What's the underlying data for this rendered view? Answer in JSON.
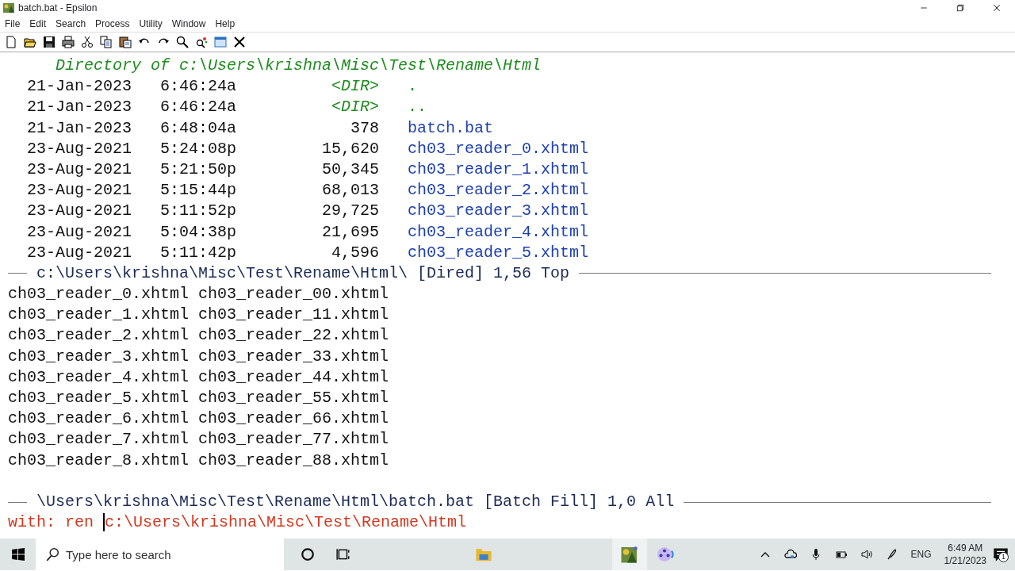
{
  "window": {
    "title": "batch.bat - Epsilon"
  },
  "menu": [
    "File",
    "Edit",
    "Search",
    "Process",
    "Utility",
    "Window",
    "Help"
  ],
  "dired": {
    "header": "Directory of c:\\Users\\krishna\\Misc\\Test\\Rename\\Html",
    "entries": [
      {
        "date": "21-Jan-2023",
        "time": "6:46:24a",
        "size": "<DIR>",
        "name": ".",
        "kind": "dir"
      },
      {
        "date": "21-Jan-2023",
        "time": "6:46:24a",
        "size": "<DIR>",
        "name": "..",
        "kind": "dir"
      },
      {
        "date": "21-Jan-2023",
        "time": "6:48:04a",
        "size": "378",
        "name": "batch.bat",
        "kind": "file"
      },
      {
        "date": "23-Aug-2021",
        "time": "5:24:08p",
        "size": "15,620",
        "name": "ch03_reader_0.xhtml",
        "kind": "file"
      },
      {
        "date": "23-Aug-2021",
        "time": "5:21:50p",
        "size": "50,345",
        "name": "ch03_reader_1.xhtml",
        "kind": "file"
      },
      {
        "date": "23-Aug-2021",
        "time": "5:15:44p",
        "size": "68,013",
        "name": "ch03_reader_2.xhtml",
        "kind": "file"
      },
      {
        "date": "23-Aug-2021",
        "time": "5:11:52p",
        "size": "29,725",
        "name": "ch03_reader_3.xhtml",
        "kind": "file"
      },
      {
        "date": "23-Aug-2021",
        "time": "5:04:38p",
        "size": "21,695",
        "name": "ch03_reader_4.xhtml",
        "kind": "file"
      },
      {
        "date": "23-Aug-2021",
        "time": "5:11:42p",
        "size": "4,596",
        "name": "ch03_reader_5.xhtml",
        "kind": "file"
      }
    ],
    "mode_line": "c:\\Users\\krishna\\Misc\\Test\\Rename\\Html\\ [Dired] 1,56 Top"
  },
  "batch": {
    "lines": [
      "ch03_reader_0.xhtml ch03_reader_00.xhtml",
      "ch03_reader_1.xhtml ch03_reader_11.xhtml",
      "ch03_reader_2.xhtml ch03_reader_22.xhtml",
      "ch03_reader_3.xhtml ch03_reader_33.xhtml",
      "ch03_reader_4.xhtml ch03_reader_44.xhtml",
      "ch03_reader_5.xhtml ch03_reader_55.xhtml",
      "ch03_reader_6.xhtml ch03_reader_66.xhtml",
      "ch03_reader_7.xhtml ch03_reader_77.xhtml",
      "ch03_reader_8.xhtml ch03_reader_88.xhtml"
    ],
    "mode_line": "\\Users\\krishna\\Misc\\Test\\Rename\\Html\\batch.bat [Batch Fill] 1,0 All"
  },
  "echo": {
    "before_cursor": "with: ren ",
    "after_cursor": "c:\\Users\\krishna\\Misc\\Test\\Rename\\Html"
  },
  "taskbar": {
    "search": {
      "placeholder": "Type here to search"
    },
    "language": "ENG",
    "time": "6:49 AM",
    "date": "1/21/2023",
    "notifications": "1"
  }
}
